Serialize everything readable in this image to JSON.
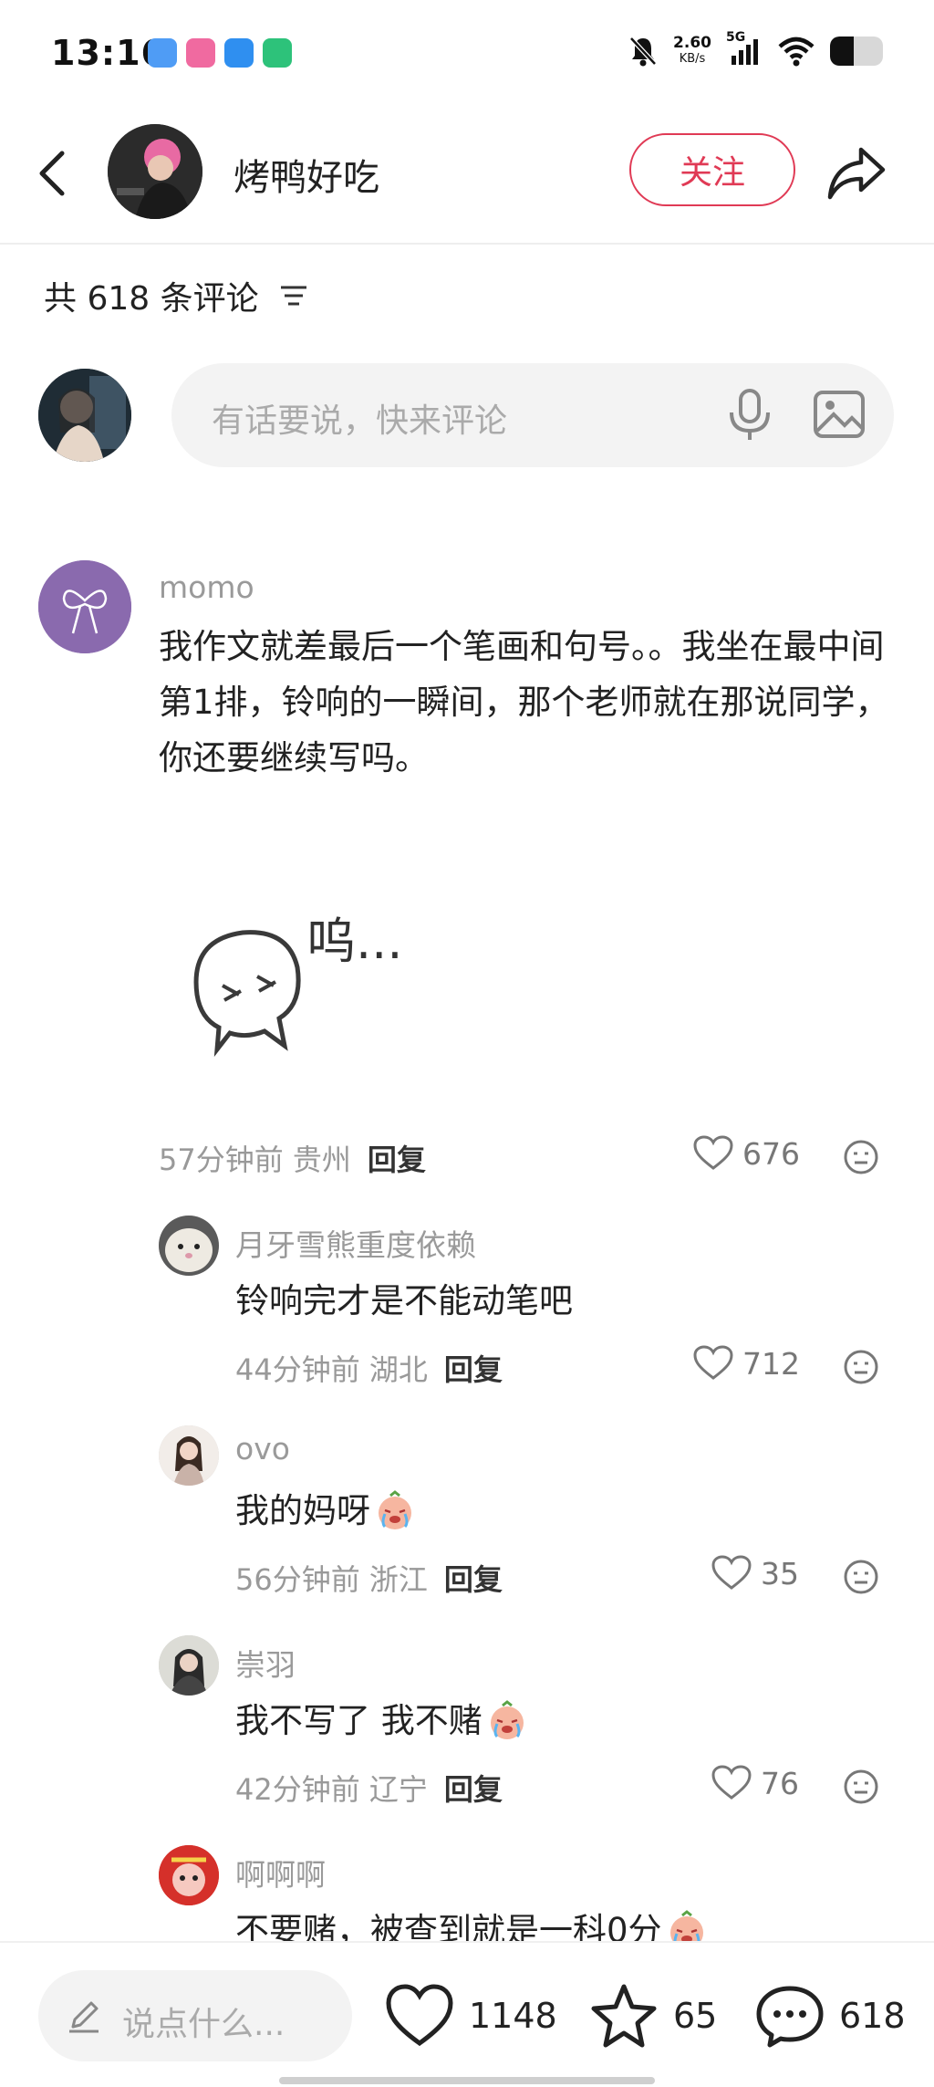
{
  "status_bar": {
    "time": "13:16",
    "net_speed_value": "2.60",
    "net_speed_unit": "KB/s",
    "network": "5G",
    "battery_level": 0.45
  },
  "header": {
    "author_name": "烤鸭好吃",
    "follow_label": "关注"
  },
  "comments_header": {
    "count_label": "共 618 条评论"
  },
  "input": {
    "placeholder": "有话要说，快来评论"
  },
  "comments": [
    {
      "name": "momo",
      "text": "我作文就差最后一个笔画和句号。。我坐在最中间第1排，铃响的一瞬间，那个老师就在那说同学，你还要继续写吗。",
      "sticker_text": "呜...",
      "meta": "57分钟前 贵州",
      "reply": "回复",
      "likes": "676"
    }
  ],
  "replies": [
    {
      "name": "月牙雪熊重度依赖",
      "text": "铃响完才是不能动笔吧",
      "meta": "44分钟前 湖北",
      "reply": "回复",
      "likes": "712"
    },
    {
      "name": "ovo",
      "text": "我的妈呀",
      "meta": "56分钟前 浙江",
      "reply": "回复",
      "likes": "35"
    },
    {
      "name": "崇羽",
      "text": "我不写了 我不赌",
      "meta": "42分钟前 辽宁",
      "reply": "回复",
      "likes": "76"
    },
    {
      "name": "啊啊啊",
      "text": "不要赌，被查到就是一科0分"
    }
  ],
  "bottom_bar": {
    "placeholder": "说点什么...",
    "likes": "1148",
    "stars": "65",
    "comments": "618"
  },
  "colors": {
    "accent": "#e03a55",
    "muted_text": "#999999",
    "input_bg": "#f3f3f3"
  }
}
